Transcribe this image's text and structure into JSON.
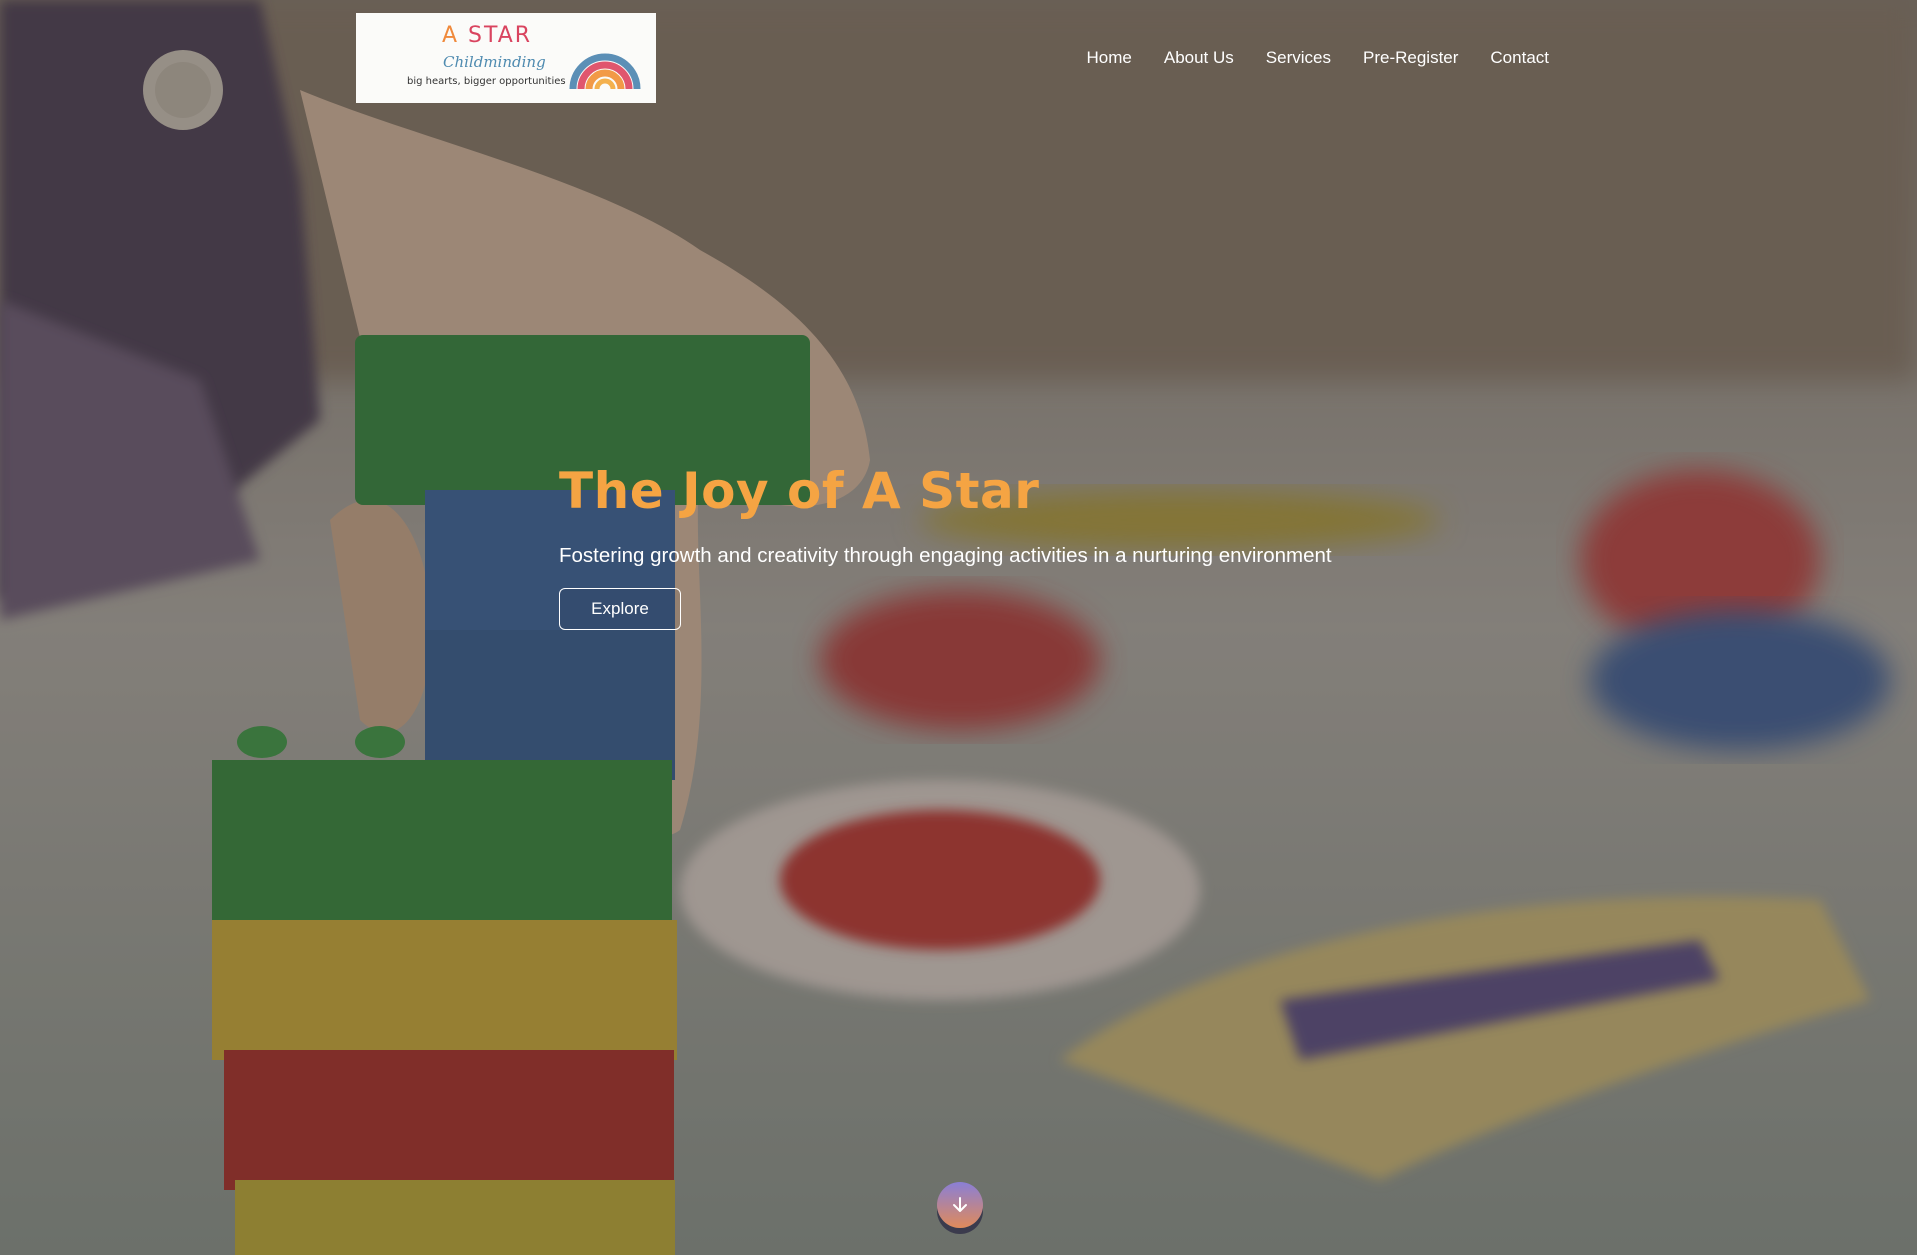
{
  "logo": {
    "title_a": "A",
    "title_rest": " STAR",
    "subtitle": "Childminding",
    "tagline": "big hearts, bigger opportunities"
  },
  "nav": {
    "items": [
      "Home",
      "About Us",
      "Services",
      "Pre-Register",
      "Contact"
    ]
  },
  "hero": {
    "title": "The Joy of A Star",
    "subtitle": "Fostering growth and creativity through engaging activities in a nurturing environment",
    "button_label": "Explore"
  },
  "scroll": {
    "icon": "arrow-down-icon"
  },
  "colors": {
    "accent": "#f5a443",
    "logo_red": "#d9445f",
    "logo_orange": "#f08a3c",
    "logo_blue": "#4f8bb0"
  }
}
